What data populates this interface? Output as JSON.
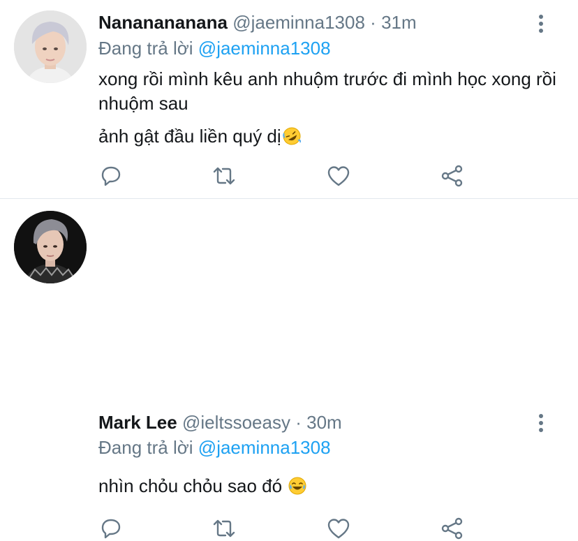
{
  "tweets": [
    {
      "name": "Nananananana",
      "handle": "@jaeminna1308",
      "separator": "·",
      "time": "31m",
      "reply_prefix": "Đang trả lời",
      "reply_to": "@jaeminna1308",
      "lines": [
        "xong rồi mình kêu anh nhuộm trước đi mình học xong rồi nhuộm sau",
        "ảnh gật đầu liền quý dị"
      ],
      "emoji": "rolling-on-floor-laughing-icon"
    },
    {
      "name": "Mark Lee",
      "handle": "@ieltssoeasy",
      "separator": "·",
      "time": "30m",
      "reply_prefix": "Đang trả lời",
      "reply_to": "@jaeminna1308",
      "lines": [
        "nhìn chỏu chỏu sao đó"
      ],
      "emoji": "tears-of-joy-icon"
    }
  ],
  "colors": {
    "text": "#14171a",
    "secondary": "#657786",
    "accent": "#1da1f2",
    "divider": "#e1e8ed"
  }
}
